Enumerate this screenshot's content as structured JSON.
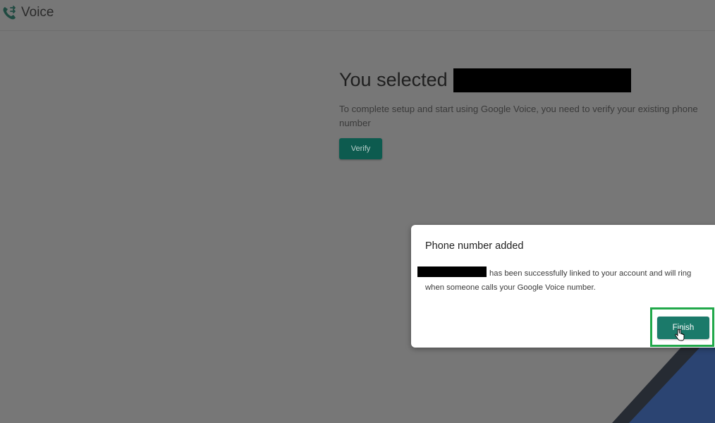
{
  "header": {
    "app_name": "Voice",
    "logo_icon": "phone-forward-icon"
  },
  "main": {
    "title": "You selected",
    "description": "To complete setup and start using Google Voice, you need to verify your existing phone number",
    "verify_label": "Verify"
  },
  "dialog": {
    "title": "Phone number added",
    "body": "has been successfully linked to your account and will ring when someone calls your Google Voice number.",
    "finish_label": "Finish"
  },
  "colors": {
    "overlay_bg": "#777777",
    "button_teal": "#1b7a6a",
    "highlight_green": "#21a84a",
    "decor_blue": "#2b4472"
  }
}
